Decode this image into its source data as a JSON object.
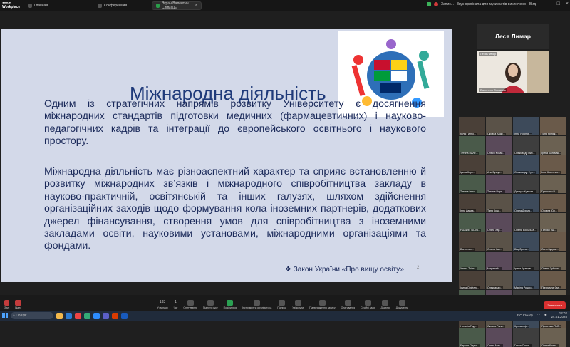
{
  "topbar": {
    "brand_line1": "zoom",
    "brand_line2": "Workplace",
    "tabs": [
      {
        "label": "Главная"
      },
      {
        "label": "Конференция"
      },
      {
        "label": "Экран Валентин Слимаць",
        "close": "×"
      }
    ],
    "status_text": "Запис...",
    "status_text2": "Звук оригінала для музикантів виключено",
    "view_label": "Вид"
  },
  "slide": {
    "title": "Міжнародна діяльність",
    "paragraph1": "Одним із стратегічних напрямів розвитку Університету є досягнення міжнародних стандартів підготовки медичних (фармацевтичних) і науково-педагогічних кадрів та інтеграції до європейського освітнього і наукового простору.",
    "paragraph2": "Міжнародна діяльність має різноаспектний характер та сприяє встановленню й розвитку міжнародних зв’язків і міжнародного співробітництва закладу в науково-практичній, освітянській та інших галузях, шляхом здійснення організаційних заходів щодо формування кола іноземних партнерів, додаткових джерел фінансування, створення умов для співробітництва з іноземними закладами освіти, науковими установами, міжнародними організаціями та фондами.",
    "law_ref": "❖ Закон України «Про вищу освіту»",
    "slide_number": "2"
  },
  "speaker": {
    "name": "Леся Лимар",
    "video_label_top": "Леся Лимар",
    "video_label_bottom": "Валентин Слимаць"
  },
  "participants": [
    "Юлія Гиппо...",
    "Оксана Андр...",
    "Інна Ясіонов...",
    "Таня Кріпак...",
    "Тетяна Мале...",
    "Олеся Кохан...",
    "Олександр Ник...",
    "Ірина Кальмак...",
    "Ірина Корн...",
    "Ала Бушук...",
    "Олександр Фур...",
    "Інна Костинко...",
    "Тетяна Ілаш...",
    "Тетяна Чорн...",
    "Дмитро Кувшин...",
    "Гринович В...",
    "Інна Давид...",
    "Таня Кош...",
    "Ольга Дрима...",
    "Оксана Юл...",
    "HUAWEI NOVA...",
    "Ольга Хар...",
    "Олена Вольська...",
    "Ганна Тиш...",
    "Валентин...",
    "Олена Кал...",
    "Відоброта...",
    "Лала Будчак...",
    "Уляна Тріль...",
    "Марина Н...",
    "Ірина Кравчук...",
    "Олена Зубова...",
    "Ірина Олійчук...",
    "Олександр...",
    "Маріна Рошко...",
    "Підтримна Ом...",
    "Олена Ірина...",
    "Ольга Корабська...",
    "Ірина Баранова...",
    "Оксана Ор...",
    "Наталія Гаур...",
    "Оксана Рапа...",
    "Крзиштоф...",
    "Ярослава Поб...",
    "Берсен Пруко...",
    "Ольга Мих...",
    "Ганна Ставн...",
    "Ольга Кравч..."
  ],
  "toolbar": {
    "left": [
      {
        "label": "Звук",
        "icon": "microphone-muted-icon"
      },
      {
        "label": "Відео",
        "icon": "camera-off-icon"
      }
    ],
    "center": [
      {
        "label": "Учасники",
        "count": "133"
      },
      {
        "label": "Чат",
        "count": "1"
      },
      {
        "label": "Опитування"
      },
      {
        "label": "Підняти руку"
      },
      {
        "label": "Поділитися"
      },
      {
        "label": "Інструменти організатора"
      },
      {
        "label": "Підписи"
      },
      {
        "label": "Увімкнути"
      },
      {
        "label": "Підтвердження запису"
      },
      {
        "label": "Опитування"
      },
      {
        "label": "Сесійні зали"
      },
      {
        "label": "Додатки"
      },
      {
        "label": "Документи"
      }
    ],
    "end_label": "Завершити"
  },
  "taskbar": {
    "search_placeholder": "Пошук",
    "weather": "3°C Cloudy",
    "time": "12:02",
    "date": "24.01.2025"
  }
}
